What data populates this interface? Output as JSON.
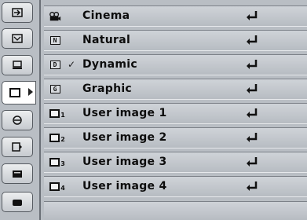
{
  "menu": {
    "items": [
      {
        "label": "Cinema",
        "icon": "film-camera-icon",
        "checked": false
      },
      {
        "label": "Natural",
        "icon": "N-mode-icon",
        "icon_letter": "N",
        "checked": false
      },
      {
        "label": "Dynamic",
        "icon": "D-mode-icon",
        "icon_letter": "D",
        "checked": true
      },
      {
        "label": "Graphic",
        "icon": "G-mode-icon",
        "icon_letter": "G",
        "checked": false
      },
      {
        "label": "User image 1",
        "icon": "user-image-icon",
        "icon_sub": "1",
        "checked": false
      },
      {
        "label": "User image 2",
        "icon": "user-image-icon",
        "icon_sub": "2",
        "checked": false
      },
      {
        "label": "User image 3",
        "icon": "user-image-icon",
        "icon_sub": "3",
        "checked": false
      },
      {
        "label": "User image 4",
        "icon": "user-image-icon",
        "icon_sub": "4",
        "checked": false
      }
    ],
    "enter_icon": "enter-arrow-icon",
    "check_glyph": "✓"
  },
  "sidebar": {
    "tabs": [
      {
        "icon": "input-icon"
      },
      {
        "icon": "pc-adjust-icon"
      },
      {
        "icon": "screen-icon"
      },
      {
        "icon": "image-select-icon",
        "active": true
      },
      {
        "icon": "image-adjust-icon"
      },
      {
        "icon": "setting-icon"
      },
      {
        "icon": "information-icon"
      }
    ]
  },
  "colors": {
    "background": "#b9bec4",
    "text": "#0d0d0d"
  }
}
